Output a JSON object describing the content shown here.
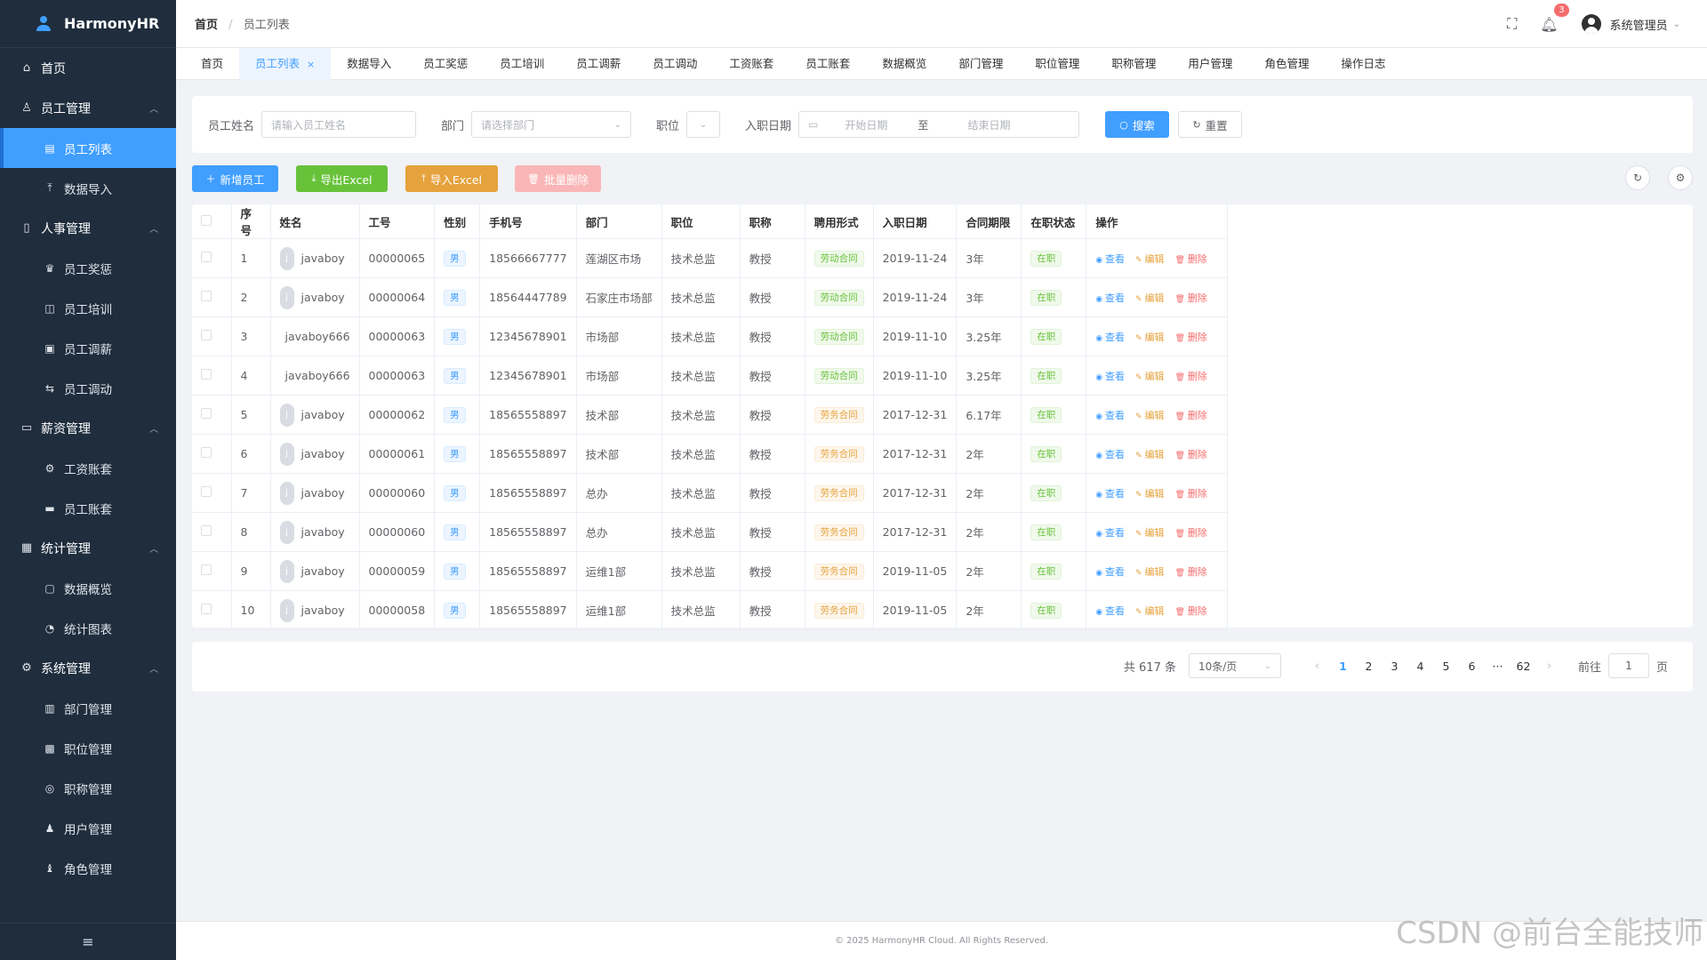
{
  "app": {
    "name": "HarmonyHR"
  },
  "colors": {
    "primary": "#409eff",
    "sidebar_bg": "#1f2d3d",
    "success": "#67c23a",
    "warning": "#e6a23c",
    "danger": "#f56c6c"
  },
  "sidebar": {
    "home": "首页",
    "groups": [
      {
        "label": "员工管理",
        "icon": "user-icon",
        "items": [
          {
            "label": "员工列表",
            "icon": "clipboard-icon",
            "active": true
          },
          {
            "label": "数据导入",
            "icon": "upload-icon"
          }
        ]
      },
      {
        "label": "人事管理",
        "icon": "document-icon",
        "items": [
          {
            "label": "员工奖惩",
            "icon": "trophy-icon"
          },
          {
            "label": "员工培训",
            "icon": "book-icon"
          },
          {
            "label": "员工调薪",
            "icon": "money-icon"
          },
          {
            "label": "员工调动",
            "icon": "transfer-icon"
          }
        ]
      },
      {
        "label": "薪资管理",
        "icon": "folder-icon",
        "items": [
          {
            "label": "工资账套",
            "icon": "gear-icon"
          },
          {
            "label": "员工账套",
            "icon": "card-icon"
          }
        ]
      },
      {
        "label": "统计管理",
        "icon": "chart-icon",
        "items": [
          {
            "label": "数据概览",
            "icon": "monitor-icon"
          },
          {
            "label": "统计图表",
            "icon": "pie-icon"
          }
        ]
      },
      {
        "label": "系统管理",
        "icon": "settings-icon",
        "items": [
          {
            "label": "部门管理",
            "icon": "building-icon"
          },
          {
            "label": "职位管理",
            "icon": "briefcase-icon"
          },
          {
            "label": "职称管理",
            "icon": "medal-icon"
          },
          {
            "label": "用户管理",
            "icon": "person-icon"
          },
          {
            "label": "角色管理",
            "icon": "role-icon"
          }
        ]
      }
    ]
  },
  "header": {
    "breadcrumb_home": "首页",
    "breadcrumb_sep": "/",
    "breadcrumb_current": "员工列表",
    "notification_count": "3",
    "user_name": "系统管理员"
  },
  "tabs": [
    {
      "label": "首页"
    },
    {
      "label": "员工列表",
      "active": true,
      "closable": true
    },
    {
      "label": "数据导入"
    },
    {
      "label": "员工奖惩"
    },
    {
      "label": "员工培训"
    },
    {
      "label": "员工调薪"
    },
    {
      "label": "员工调动"
    },
    {
      "label": "工资账套"
    },
    {
      "label": "员工账套"
    },
    {
      "label": "数据概览"
    },
    {
      "label": "部门管理"
    },
    {
      "label": "职位管理"
    },
    {
      "label": "职称管理"
    },
    {
      "label": "用户管理"
    },
    {
      "label": "角色管理"
    },
    {
      "label": "操作日志"
    }
  ],
  "search": {
    "name_label": "员工姓名",
    "name_placeholder": "请输入员工姓名",
    "dept_label": "部门",
    "dept_placeholder": "请选择部门",
    "position_label": "职位",
    "date_label": "入职日期",
    "date_start_placeholder": "开始日期",
    "date_sep": "至",
    "date_end_placeholder": "结束日期",
    "search_button": "搜索",
    "reset_button": "重置"
  },
  "toolbar": {
    "add_button": "新增员工",
    "export_button": "导出Excel",
    "import_button": "导入Excel",
    "batch_delete_button": "批量删除"
  },
  "table": {
    "columns": [
      "序号",
      "姓名",
      "工号",
      "性别",
      "手机号",
      "部门",
      "职位",
      "职称",
      "聘用形式",
      "入职日期",
      "合同期限",
      "在职状态",
      "操作"
    ],
    "actions": {
      "view": "查看",
      "edit": "编辑",
      "delete": "删除"
    },
    "rows": [
      {
        "idx": "1",
        "avatar": "j",
        "name": "javaboy",
        "no": "00000065",
        "gender": "男",
        "phone": "18566667777",
        "dept": "莲湖区市场",
        "position": "技术总监",
        "title": "教授",
        "hire": "劳动合同",
        "date": "2019-11-24",
        "term": "3年",
        "status": "在职"
      },
      {
        "idx": "2",
        "avatar": "j",
        "name": "javaboy",
        "no": "00000064",
        "gender": "男",
        "phone": "18564447789",
        "dept": "石家庄市场部",
        "position": "技术总监",
        "title": "教授",
        "hire": "劳动合同",
        "date": "2019-11-24",
        "term": "3年",
        "status": "在职"
      },
      {
        "idx": "3",
        "avatar": "",
        "name": "javaboy666",
        "no": "00000063",
        "gender": "男",
        "phone": "12345678901",
        "dept": "市场部",
        "position": "技术总监",
        "title": "教授",
        "hire": "劳动合同",
        "date": "2019-11-10",
        "term": "3.25年",
        "status": "在职"
      },
      {
        "idx": "4",
        "avatar": "",
        "name": "javaboy666",
        "no": "00000063",
        "gender": "男",
        "phone": "12345678901",
        "dept": "市场部",
        "position": "技术总监",
        "title": "教授",
        "hire": "劳动合同",
        "date": "2019-11-10",
        "term": "3.25年",
        "status": "在职"
      },
      {
        "idx": "5",
        "avatar": "j",
        "name": "javaboy",
        "no": "00000062",
        "gender": "男",
        "phone": "18565558897",
        "dept": "技术部",
        "position": "技术总监",
        "title": "教授",
        "hire": "劳务合同",
        "date": "2017-12-31",
        "term": "6.17年",
        "status": "在职"
      },
      {
        "idx": "6",
        "avatar": "j",
        "name": "javaboy",
        "no": "00000061",
        "gender": "男",
        "phone": "18565558897",
        "dept": "技术部",
        "position": "技术总监",
        "title": "教授",
        "hire": "劳务合同",
        "date": "2017-12-31",
        "term": "2年",
        "status": "在职"
      },
      {
        "idx": "7",
        "avatar": "j",
        "name": "javaboy",
        "no": "00000060",
        "gender": "男",
        "phone": "18565558897",
        "dept": "总办",
        "position": "技术总监",
        "title": "教授",
        "hire": "劳务合同",
        "date": "2017-12-31",
        "term": "2年",
        "status": "在职"
      },
      {
        "idx": "8",
        "avatar": "j",
        "name": "javaboy",
        "no": "00000060",
        "gender": "男",
        "phone": "18565558897",
        "dept": "总办",
        "position": "技术总监",
        "title": "教授",
        "hire": "劳务合同",
        "date": "2017-12-31",
        "term": "2年",
        "status": "在职"
      },
      {
        "idx": "9",
        "avatar": "j",
        "name": "javaboy",
        "no": "00000059",
        "gender": "男",
        "phone": "18565558897",
        "dept": "运维1部",
        "position": "技术总监",
        "title": "教授",
        "hire": "劳务合同",
        "date": "2019-11-05",
        "term": "2年",
        "status": "在职"
      },
      {
        "idx": "10",
        "avatar": "j",
        "name": "javaboy",
        "no": "00000058",
        "gender": "男",
        "phone": "18565558897",
        "dept": "运维1部",
        "position": "技术总监",
        "title": "教授",
        "hire": "劳务合同",
        "date": "2019-11-05",
        "term": "2年",
        "status": "在职"
      }
    ]
  },
  "pagination": {
    "total_text": "共 617 条",
    "page_size": "10条/页",
    "pages": [
      "1",
      "2",
      "3",
      "4",
      "5",
      "6",
      "···",
      "62"
    ],
    "current": "1",
    "goto_label": "前往",
    "goto_value": "1",
    "page_suffix": "页"
  },
  "footer": {
    "copyright": "© 2025 HarmonyHR Cloud. All Rights Reserved."
  },
  "watermark": "CSDN @前台全能技师"
}
